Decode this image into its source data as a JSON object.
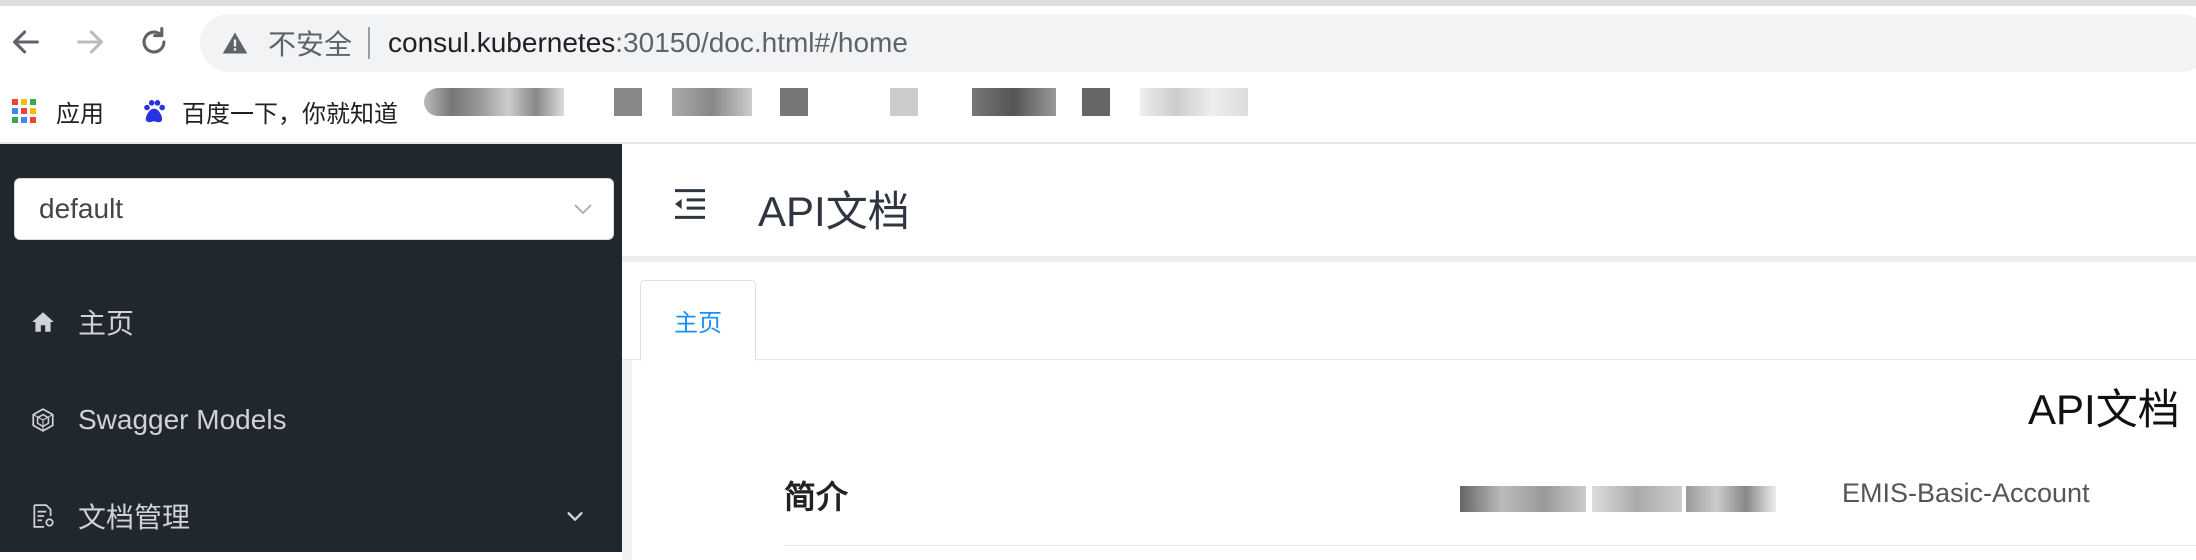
{
  "browser": {
    "url_host": "consul.kubernetes",
    "url_rest": ":30150/doc.html#/home",
    "security_label": "不安全",
    "bookmarks": {
      "apps_label": "应用",
      "baidu_label": "百度一下，你就知道"
    }
  },
  "sidebar": {
    "group_select_value": "default",
    "items": [
      {
        "label": "主页",
        "icon": "home-icon"
      },
      {
        "label": "Swagger Models",
        "icon": "cube-icon"
      },
      {
        "label": "文档管理",
        "icon": "doc-manage-icon"
      }
    ]
  },
  "header": {
    "title": "API文档"
  },
  "tabs": [
    {
      "label": "主页",
      "active": true
    }
  ],
  "content": {
    "doc_title": "API文档",
    "intro_label": "简介",
    "intro_value": "EMIS-Basic-Account"
  },
  "colors": {
    "sidebar_bg": "#20282e",
    "accent": "#1890ff"
  }
}
